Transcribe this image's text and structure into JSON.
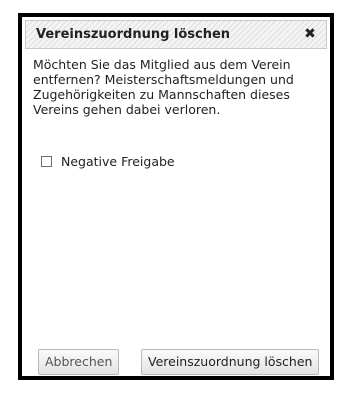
{
  "dialog": {
    "title": "Vereinszuordnung löschen",
    "close_glyph": "✖",
    "message_lines": [
      "Möchten Sie das Mitglied aus dem Verein",
      "entfernen? Meisterschaftsmeldungen und",
      "Zugehörigkeiten zu Mannschaften dieses",
      "Vereins gehen dabei verloren."
    ],
    "checkbox": {
      "label": "Negative Freigabe",
      "checked": false
    },
    "buttons": {
      "cancel_label": "Abbrechen",
      "confirm_label": "Vereinszuordnung löschen"
    }
  },
  "icons": {
    "close": "close-icon"
  }
}
